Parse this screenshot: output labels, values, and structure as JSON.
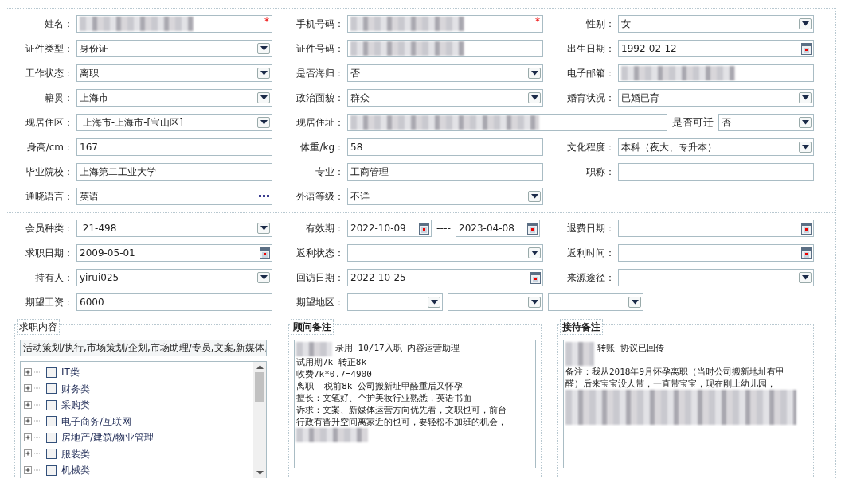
{
  "sections": [
    {
      "rows": [
        [
          {
            "label": "姓名：",
            "controls": [
              {
                "kind": "text",
                "redacted": true,
                "required_mark": "*"
              }
            ]
          },
          {
            "label": "手机号码：",
            "controls": [
              {
                "kind": "text",
                "redacted": true,
                "required_mark": "*"
              }
            ]
          },
          {
            "label": "性别：",
            "controls": [
              {
                "kind": "select",
                "value": "女"
              }
            ]
          }
        ],
        [
          {
            "label": "证件类型：",
            "controls": [
              {
                "kind": "select",
                "value": "身份证"
              }
            ]
          },
          {
            "label": "证件号码：",
            "controls": [
              {
                "kind": "text",
                "redacted": true
              }
            ]
          },
          {
            "label": "出生日期：",
            "controls": [
              {
                "kind": "date",
                "value": "1992-02-12"
              }
            ]
          }
        ],
        [
          {
            "label": "工作状态：",
            "controls": [
              {
                "kind": "select",
                "value": "离职"
              }
            ]
          },
          {
            "label": "是否海归：",
            "controls": [
              {
                "kind": "select",
                "value": "否"
              }
            ]
          },
          {
            "label": "电子邮箱：",
            "controls": [
              {
                "kind": "text",
                "redacted": true
              }
            ]
          }
        ],
        [
          {
            "label": "籍贯：",
            "controls": [
              {
                "kind": "select",
                "value": "上海市"
              }
            ]
          },
          {
            "label": "政治面貌：",
            "controls": [
              {
                "kind": "select",
                "value": "群众"
              }
            ]
          },
          {
            "label": "婚育状况：",
            "controls": [
              {
                "kind": "select",
                "value": "已婚已育"
              }
            ]
          }
        ],
        [
          {
            "label": "现居住区：",
            "controls": [
              {
                "kind": "select",
                "value": " 上海市-上海市-[宝山区]"
              }
            ]
          },
          {
            "label": "现居住址：",
            "controls": [
              {
                "kind": "text",
                "redacted": true
              },
              {
                "kind": "label",
                "value": "是否可迁"
              },
              {
                "kind": "select",
                "value": "否"
              }
            ]
          }
        ],
        [
          {
            "label": "身高/cm：",
            "controls": [
              {
                "kind": "text",
                "value": "167"
              }
            ]
          },
          {
            "label": "体重/kg：",
            "controls": [
              {
                "kind": "text",
                "value": "58"
              }
            ]
          },
          {
            "label": "文化程度：",
            "controls": [
              {
                "kind": "select",
                "value": "本科（夜大、专升本）"
              }
            ]
          }
        ],
        [
          {
            "label": "毕业院校：",
            "controls": [
              {
                "kind": "text",
                "value": "上海第二工业大学"
              }
            ]
          },
          {
            "label": "专业：",
            "controls": [
              {
                "kind": "text",
                "value": "工商管理"
              }
            ]
          },
          {
            "label": "职称：",
            "controls": [
              {
                "kind": "text"
              }
            ]
          }
        ],
        [
          {
            "label": "通晓语言：",
            "controls": [
              {
                "kind": "lookup",
                "value": "英语"
              }
            ]
          },
          {
            "label": "外语等级：",
            "controls": [
              {
                "kind": "select",
                "value": "不详"
              }
            ]
          },
          null
        ]
      ]
    },
    {
      "rows": [
        [
          {
            "label": "会员种类：",
            "controls": [
              {
                "kind": "select",
                "value": " 21-498"
              }
            ]
          },
          {
            "label": "有效期：",
            "controls": [
              {
                "kind": "date",
                "value": "2022-10-09"
              },
              {
                "kind": "label",
                "value": "----"
              },
              {
                "kind": "date",
                "value": "2023-04-08"
              }
            ]
          },
          {
            "label": "退费日期：",
            "controls": [
              {
                "kind": "date"
              }
            ]
          }
        ],
        [
          {
            "label": "求职日期：",
            "controls": [
              {
                "kind": "date",
                "value": "2009-05-01"
              }
            ]
          },
          {
            "label": "返利状态：",
            "controls": [
              {
                "kind": "select"
              }
            ]
          },
          {
            "label": "返利时间：",
            "controls": [
              {
                "kind": "date"
              }
            ]
          }
        ],
        [
          {
            "label": "持有人：",
            "controls": [
              {
                "kind": "select",
                "value": "yirui025"
              }
            ]
          },
          {
            "label": "回访日期：",
            "controls": [
              {
                "kind": "date",
                "value": "2022-10-25"
              }
            ]
          },
          {
            "label": "来源途径：",
            "controls": [
              {
                "kind": "select"
              }
            ]
          }
        ],
        [
          {
            "label": "期望工资：",
            "controls": [
              {
                "kind": "text",
                "value": "6000"
              }
            ]
          },
          {
            "label": "期望地区：",
            "controls": [
              {
                "kind": "select"
              },
              {
                "kind": "select"
              },
              {
                "kind": "select"
              }
            ]
          },
          null
        ]
      ]
    }
  ],
  "job_panel": {
    "title": "求职内容",
    "summary": "活动策划/执行,市场策划/企划,市场助理/专员,文案,新媒体,",
    "tree": [
      {
        "label": "IT类",
        "checked": false,
        "expanded": false
      },
      {
        "label": "财务类",
        "checked": false,
        "expanded": false
      },
      {
        "label": "采购类",
        "checked": false,
        "expanded": false
      },
      {
        "label": "电子商务/互联网",
        "checked": false,
        "expanded": false
      },
      {
        "label": "房地产/建筑/物业管理",
        "checked": false,
        "expanded": false
      },
      {
        "label": "服装类",
        "checked": false,
        "expanded": false
      },
      {
        "label": "机械类",
        "checked": false,
        "expanded": false
      }
    ]
  },
  "note_panels": [
    {
      "title": "顾问备注",
      "lines": [
        {
          "text": "录用 10/17入职 内容运营助理",
          "redacted": true
        },
        {
          "text": "试用期7k 转正8k"
        },
        {
          "text": "收费7k*0.7=4900"
        },
        {
          "text": "离职  税前8k 公司搬新址甲醛重后又怀孕"
        },
        {
          "text": "擅长：文笔好、个护美妆行业熟悉，英语书面"
        },
        {
          "text": "诉求：文案、新媒体运营方向优先看，文职也可，前台"
        },
        {
          "text": "行政有晋升空间离家近的也可，要轻松不加班的机会，"
        },
        {
          "redacted": true
        }
      ]
    },
    {
      "title": "接待备注",
      "lines": [
        {
          "text": "转账 协议已回传",
          "redacted": true
        },
        {
          "text": "备注：我从2018年9月怀孕离职（当时公司搬新地址有甲"
        },
        {
          "text": "醛）后来宝宝没人带，一直带宝宝，现在刚上幼儿园，"
        },
        {
          "redacted": true
        }
      ]
    }
  ]
}
